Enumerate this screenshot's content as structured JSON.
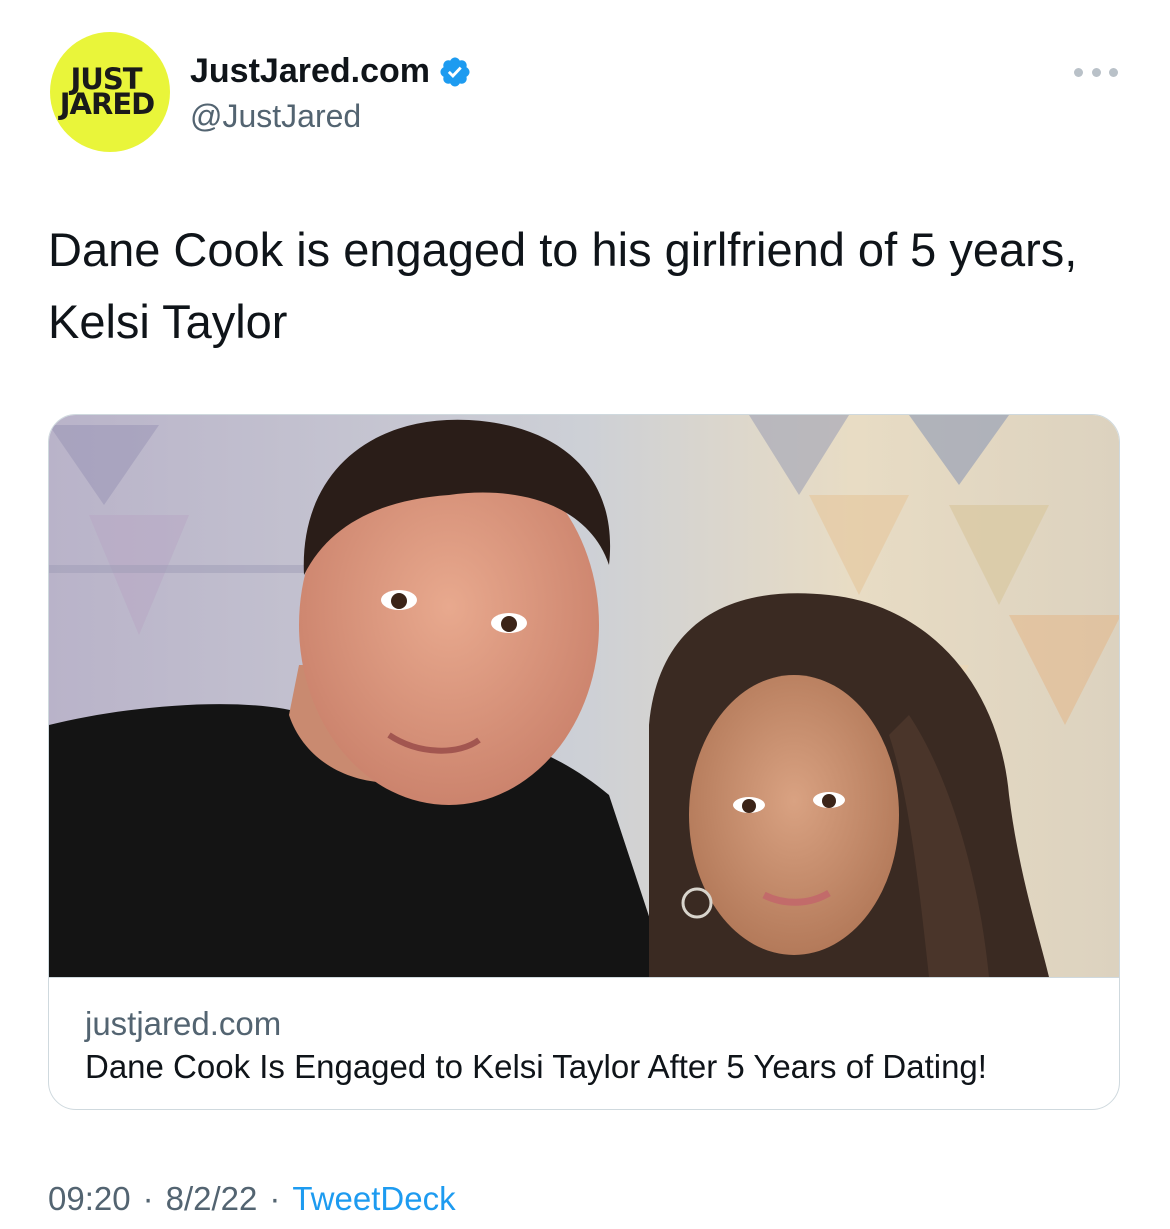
{
  "account": {
    "avatar_line1": "JUST",
    "avatar_line2": "JARED",
    "display_name": "JustJared.com",
    "handle": "@JustJared",
    "verified": true
  },
  "tweet": {
    "text": "Dane Cook is engaged to his girlfriend of 5 years, Kelsi Taylor"
  },
  "link_card": {
    "domain": "justjared.com",
    "title": "Dane Cook Is Engaged to Kelsi Taylor After 5 Years of Dating!",
    "image_description_icon": "photo"
  },
  "meta": {
    "time": "09:20",
    "date": "8/2/22",
    "separator": "·",
    "source": "TweetDeck"
  },
  "colors": {
    "avatar_bg": "#e9f53a",
    "verified": "#1d9bf0",
    "secondary_text": "#536471",
    "link": "#1d9bf0",
    "border": "#cfd9de"
  }
}
